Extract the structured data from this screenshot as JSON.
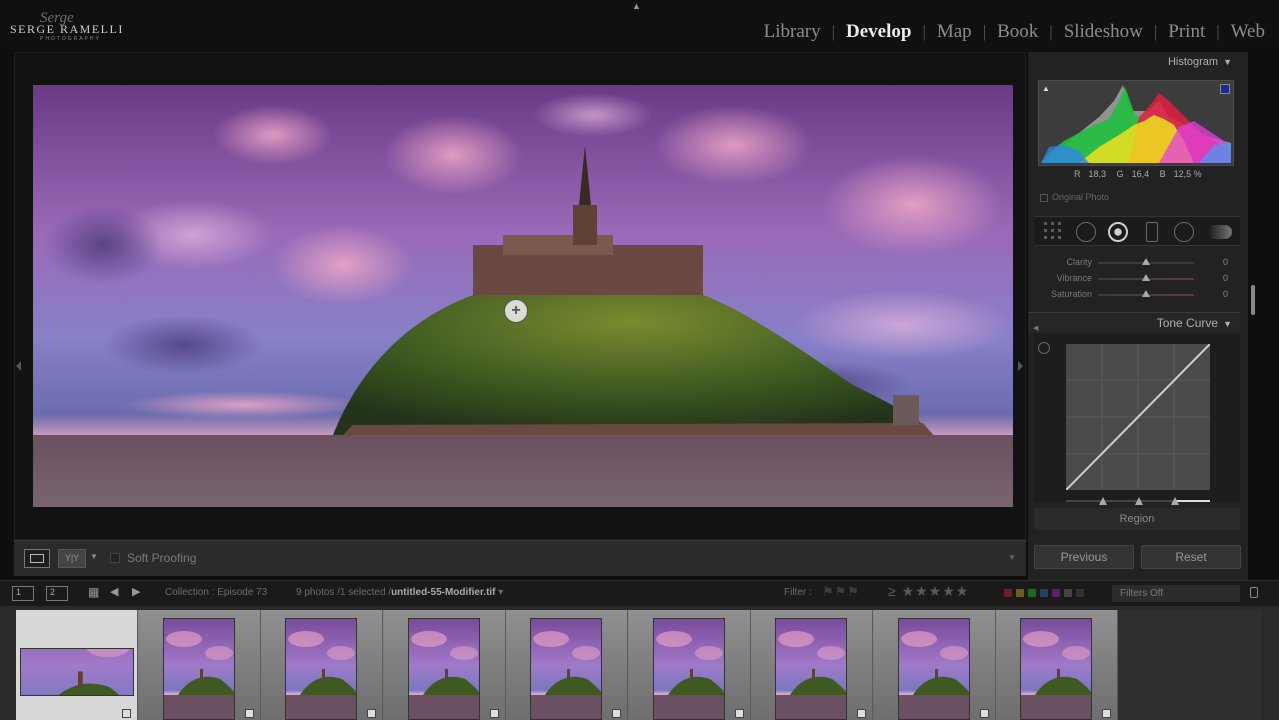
{
  "app": {
    "brand": "SERGE RAMELLI",
    "brand_sub": "PHOTOGRAPHY",
    "brand_script": "Serge"
  },
  "modules": [
    {
      "label": "Library",
      "active": false
    },
    {
      "label": "Develop",
      "active": true
    },
    {
      "label": "Map",
      "active": false
    },
    {
      "label": "Book",
      "active": false
    },
    {
      "label": "Slideshow",
      "active": false
    },
    {
      "label": "Print",
      "active": false
    },
    {
      "label": "Web",
      "active": false
    }
  ],
  "toolbar": {
    "soft_proofing_label": "Soft Proofing",
    "soft_proofing_checked": false
  },
  "right_panel": {
    "histogram_title": "Histogram",
    "histogram_values": {
      "r": "18,3",
      "g": "16,4",
      "b": "12,5 %"
    },
    "original_photo_label": "Original Photo",
    "presence": [
      {
        "label": "Clarity",
        "value": "0"
      },
      {
        "label": "Vibrance",
        "value": "0"
      },
      {
        "label": "Saturation",
        "value": "0"
      }
    ],
    "tone_curve_title": "Tone Curve",
    "region_label": "Region",
    "previous_button": "Previous",
    "reset_button": "Reset"
  },
  "filmbar": {
    "collection": "Collection : Episode 73",
    "count_prefix": "9 photos /1 selected /",
    "filename": "untitled-55-Modifier.tif",
    "filter_label": "Filter :",
    "stars": "★★★★★",
    "filters_off": "Filters Off"
  },
  "filmstrip": {
    "photo_count": 9,
    "selected_index": 0
  },
  "colors": {
    "accent_active": "#ececec",
    "panel_bg": "#222222",
    "filmstrip_bg": "#2a2a2a"
  },
  "icons": [
    "loupe-view-icon",
    "compare-view-icon",
    "grid-icon",
    "back-arrow-icon",
    "forward-arrow-icon",
    "lock-icon",
    "target-adjust-icon",
    "crop-tool-icon",
    "spot-removal-icon",
    "red-eye-icon",
    "graduated-filter-icon",
    "radial-filter-icon",
    "adjustment-brush-icon"
  ]
}
